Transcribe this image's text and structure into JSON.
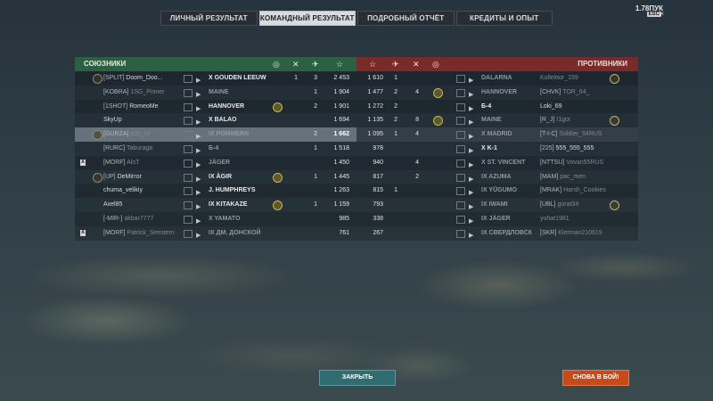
{
  "tabs": [
    {
      "label": "ЛИЧНЫЙ РЕЗУЛЬТАТ",
      "active": false
    },
    {
      "label": "КОМАНДНЫЙ РЕЗУЛЬТАТ",
      "active": true
    },
    {
      "label": "ПОДРОБНЫЙ ОТЧЁТ",
      "active": false
    },
    {
      "label": "КРЕДИТЫ И ОПЫТ",
      "active": false
    }
  ],
  "top_right": {
    "text": "1.78ПУК",
    "esc": "ESC",
    "close": "×"
  },
  "allies_label": "СОЮЗНИКИ",
  "enemies_label": "ПРОТИВНИКИ",
  "header_icons": {
    "medal": "medal-icon",
    "kills": "crossed-swords-icon",
    "planes": "plane-icon",
    "xp": "star-icon"
  },
  "allies": [
    {
      "clan": "[SPLIT]",
      "player": "Doom_Doo...",
      "ship": "X GOUDEN LEEUW",
      "medal": "",
      "kills": "1",
      "planes": "3",
      "xp": "2 453",
      "badge": true,
      "square": "",
      "dim": false,
      "hl": false
    },
    {
      "clan": "[KOBRA]",
      "player": "1SG_Pioner",
      "ship": "MAINE",
      "medal": "",
      "kills": "",
      "planes": "1",
      "xp": "1 904",
      "badge": false,
      "square": "",
      "dim": true,
      "hl": false
    },
    {
      "clan": "[1SHOT]",
      "player": "RomeoMe",
      "ship": "HANNOVER",
      "medal": "yes",
      "kills": "",
      "planes": "2",
      "xp": "1 901",
      "badge": false,
      "square": "",
      "dim": false,
      "hl": false
    },
    {
      "clan": "",
      "player": "SkyUp",
      "ship": "X BALAO",
      "medal": "",
      "kills": "",
      "planes": "",
      "xp": "1 694",
      "badge": false,
      "square": "",
      "dim": false,
      "hl": false
    },
    {
      "clan": "[GURZA]",
      "player": "p2k_ist",
      "ship": "IX POMMERN",
      "medal": "",
      "kills": "",
      "planes": "2",
      "xp": "1 662",
      "badge": true,
      "square": "",
      "dim": true,
      "hl": true
    },
    {
      "clan": "[RURC]",
      "player": "Taburaga",
      "ship": "Б-4",
      "medal": "",
      "kills": "",
      "planes": "1",
      "xp": "1 518",
      "badge": false,
      "square": "",
      "dim": true,
      "hl": false
    },
    {
      "clan": "[MORF]",
      "player": "AloT",
      "ship": "JÄGER",
      "medal": "",
      "kills": "",
      "planes": "",
      "xp": "1 450",
      "badge": false,
      "square": "A",
      "dim": true,
      "hl": false
    },
    {
      "clan": "[UP]",
      "player": "DeMirror",
      "ship": "IX ÄGIR",
      "medal": "yes",
      "kills": "",
      "planes": "1",
      "xp": "1 445",
      "badge": true,
      "square": "",
      "dim": false,
      "hl": false
    },
    {
      "clan": "",
      "player": "chuma_velikiy",
      "ship": "J. HUMPHREYS",
      "medal": "",
      "kills": "",
      "planes": "",
      "xp": "1 263",
      "badge": false,
      "square": "",
      "dim": false,
      "hl": false
    },
    {
      "clan": "",
      "player": "Axel85",
      "ship": "IX KITAKAZE",
      "medal": "yes",
      "kills": "",
      "planes": "1",
      "xp": "1 159",
      "badge": false,
      "square": "",
      "dim": false,
      "hl": false
    },
    {
      "clan": "[-MIR-]",
      "player": "akbar7777",
      "ship": "X YAMATO",
      "medal": "",
      "kills": "",
      "planes": "",
      "xp": "985",
      "badge": false,
      "square": "",
      "dim": true,
      "hl": false
    },
    {
      "clan": "[MORF]",
      "player": "Patrick_Seestern",
      "ship": "IX ДМ. ДОНСКОЙ",
      "medal": "",
      "kills": "",
      "planes": "",
      "xp": "761",
      "badge": false,
      "square": "A",
      "dim": true,
      "hl": false
    }
  ],
  "enemies": [
    {
      "xp": "1 610",
      "planes": "1",
      "kills": "",
      "medal": "",
      "ship": "DALARNA",
      "player": "Kollektor_159",
      "clan": "",
      "badge": true,
      "dim": true
    },
    {
      "xp": "1 477",
      "planes": "2",
      "kills": "4",
      "medal": "yes",
      "ship": "HANNOVER",
      "player": "TOR_64_",
      "clan": "[CHVK]",
      "badge": false,
      "dim": true
    },
    {
      "xp": "1 272",
      "planes": "2",
      "kills": "",
      "medal": "",
      "ship": "Б-4",
      "player": "Loki_69",
      "clan": "",
      "badge": false,
      "dim": false
    },
    {
      "xp": "1 135",
      "planes": "2",
      "kills": "8",
      "medal": "yes",
      "ship": "MAINE",
      "player": "I1gor",
      "clan": "[R_J]",
      "badge": true,
      "dim": true
    },
    {
      "xp": "1 095",
      "planes": "1",
      "kills": "4",
      "medal": "",
      "ship": "X MADRID",
      "player": "Soldier_54RUS",
      "clan": "[T-I-C]",
      "badge": false,
      "dim": true
    },
    {
      "xp": "978",
      "planes": "",
      "kills": "",
      "medal": "",
      "ship": "X K-1",
      "player": "555_555_555",
      "clan": "[225]",
      "badge": false,
      "dim": false
    },
    {
      "xp": "940",
      "planes": "",
      "kills": "4",
      "medal": "",
      "ship": "X ST. VINCENT",
      "player": "Vovan55RUS",
      "clan": "[NTTSU]",
      "badge": false,
      "dim": true
    },
    {
      "xp": "817",
      "planes": "",
      "kills": "2",
      "medal": "",
      "ship": "IX AZUMA",
      "player": "pac_men",
      "clan": "[MAM]",
      "badge": false,
      "dim": true
    },
    {
      "xp": "815",
      "planes": "1",
      "kills": "",
      "medal": "",
      "ship": "IX YŪGUMO",
      "player": "Harsh_Cookies",
      "clan": "[MRAK]",
      "badge": false,
      "dim": true
    },
    {
      "xp": "793",
      "planes": "",
      "kills": "",
      "medal": "",
      "ship": "IX IWAMI",
      "player": "gorat34",
      "clan": "[UBL]",
      "badge": true,
      "dim": true
    },
    {
      "xp": "338",
      "planes": "",
      "kills": "",
      "medal": "",
      "ship": "IX JÄGER",
      "player": "yuhat1981",
      "clan": "",
      "badge": false,
      "dim": true
    },
    {
      "xp": "267",
      "planes": "",
      "kills": "",
      "medal": "",
      "ship": "IX СВЕРДЛОВСК",
      "player": "Klerman210619",
      "clan": "[SKR]",
      "badge": false,
      "dim": true
    }
  ],
  "buttons": {
    "close": "ЗАКРЫТЬ",
    "battle": "СНОВА В БОЙ!"
  }
}
